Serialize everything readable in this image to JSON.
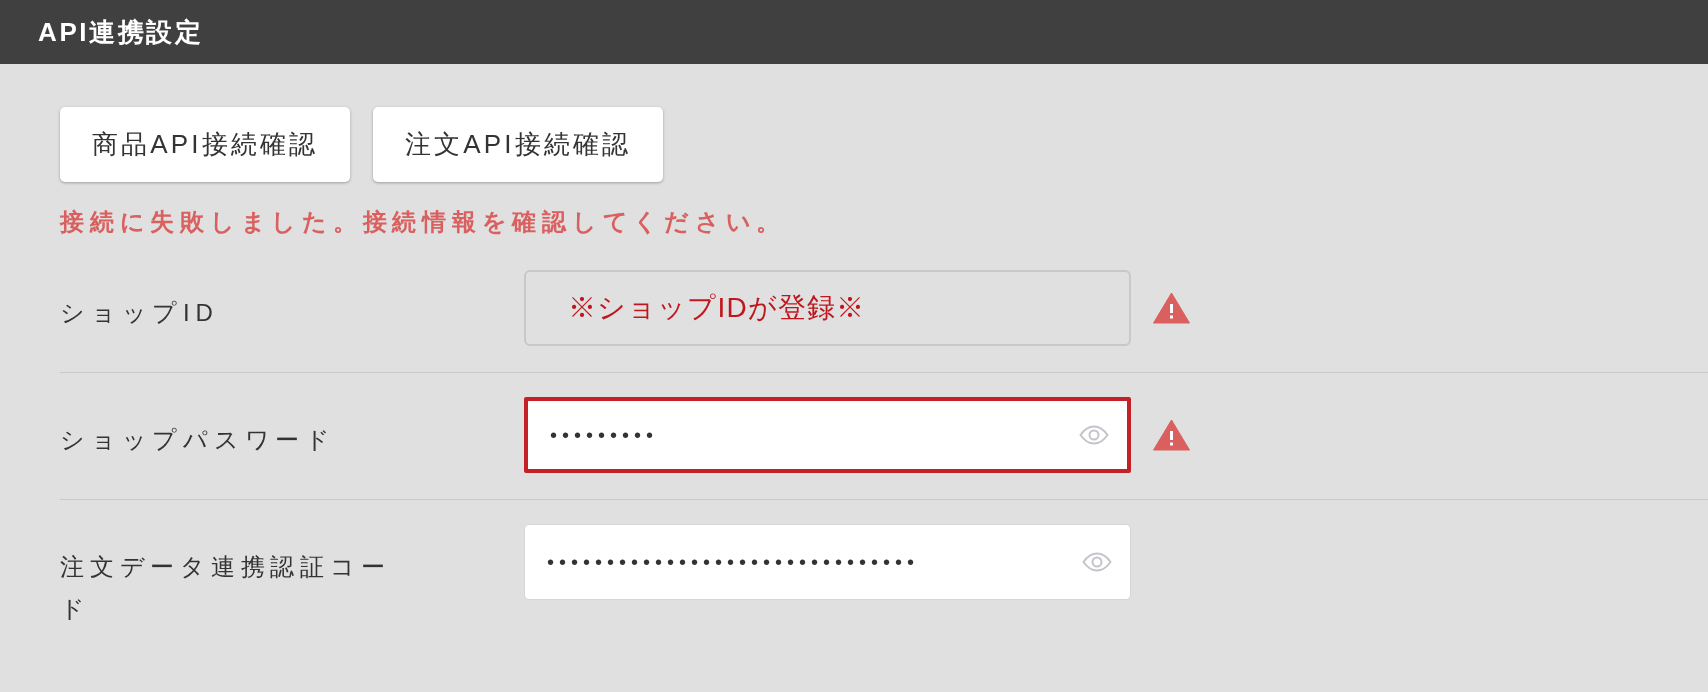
{
  "header": {
    "title": "API連携設定"
  },
  "buttons": [
    {
      "label": "商品API接続確認"
    },
    {
      "label": "注文API接続確認"
    }
  ],
  "error_message": "接続に失敗しました。接続情報を確認してください。",
  "fields": [
    {
      "label": "ショップID",
      "kind": "text",
      "value": "※ショップIDが登録※",
      "disabled": true,
      "focused": false,
      "warning": true
    },
    {
      "label": "ショップパスワード",
      "kind": "password",
      "value": "•••••••••",
      "disabled": false,
      "focused": true,
      "warning": true
    },
    {
      "label": "注文データ連携認証コード",
      "kind": "password",
      "value": "•••••••••••••••••••••••••••••••",
      "disabled": false,
      "focused": false,
      "warning": false
    }
  ]
}
